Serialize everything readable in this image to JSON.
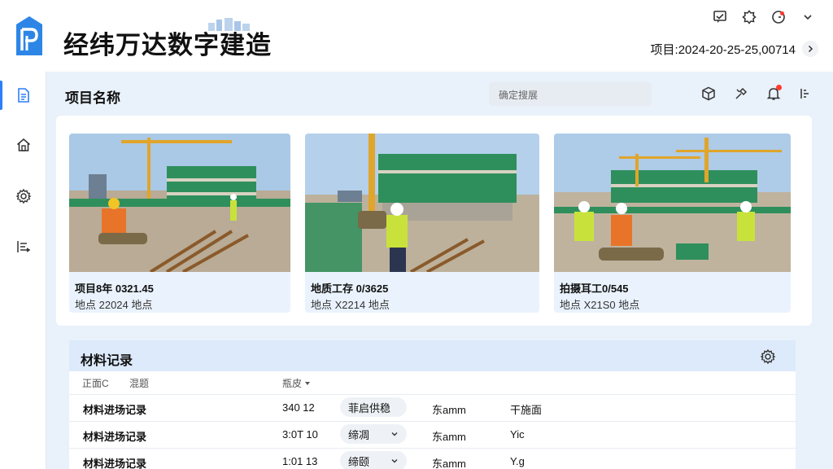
{
  "header": {
    "brand": "经纬万达数字建造",
    "project_label": "项目:2024-20-25-25,00714"
  },
  "toolbar": {
    "title": "项目名称",
    "search_placeholder": "确定搜展"
  },
  "photos": [
    {
      "caption": "项目8年 0321.45",
      "sub": "地点 22024 地点"
    },
    {
      "caption": "地质工存 0/3625",
      "sub": "地点 X2214 地点"
    },
    {
      "caption": "拍摄耳工0/545",
      "sub": "地点 X21S0 地点"
    }
  ],
  "records": {
    "title": "材料记录",
    "columns": [
      "正面C",
      "混题",
      "瓶皮"
    ],
    "rows": [
      {
        "name": "材料进场记录",
        "qty": "340 12",
        "status": "菲启供稳",
        "has_dropdown": false,
        "spec": "东amm",
        "note": "干施面"
      },
      {
        "name": "材料进场记录",
        "qty": "3:0T 10",
        "status": "缔凋",
        "has_dropdown": true,
        "spec": "东amm",
        "note": "Yic"
      },
      {
        "name": "材料进场记录",
        "qty": "1:01 13",
        "status": "缔颐",
        "has_dropdown": true,
        "spec": "东amm",
        "note": "Y.g"
      }
    ]
  },
  "colors": {
    "accent": "#2d7ff9",
    "page_bg": "#e9f1fa",
    "header_bar": "#dceafb",
    "notification_dot": "#ff3b30"
  }
}
